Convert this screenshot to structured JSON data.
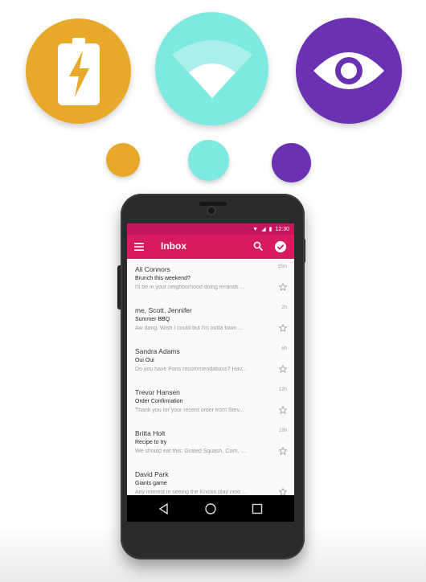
{
  "colors": {
    "battery": "#e8a82a",
    "wifi": "#7ee9e0",
    "eye": "#6a32b3",
    "toolbar": "#d81b60",
    "statusbar": "#c2185b",
    "fab": "#5ee6dd"
  },
  "icons": {
    "big": [
      "battery-charging-icon",
      "wifi-icon",
      "eye-icon"
    ],
    "small": [
      "orange-dot",
      "aqua-dot",
      "purple-dot"
    ]
  },
  "status": {
    "time": "12:30"
  },
  "toolbar": {
    "title": "Inbox"
  },
  "emails": [
    {
      "sender": "Ali Connors",
      "time": "15m",
      "subject": "Brunch this weekend?",
      "preview": "I'll be in your neighborhood doing errands ..."
    },
    {
      "sender": "me, Scott, Jennifer",
      "time": "2h",
      "subject": "Summer BBQ",
      "preview": "Aw dang. Wish I could but I'm outta town ..."
    },
    {
      "sender": "Sandra Adams",
      "time": "6h",
      "subject": "Oui Oui",
      "preview": "Do you have Paris recommendations? Hav..."
    },
    {
      "sender": "Trevor Hansen",
      "time": "12h",
      "subject": "Order Confirmation",
      "preview": "Thank you for your recent order from Stev..."
    },
    {
      "sender": "Britta Holt",
      "time": "18h",
      "subject": "Recipe to try",
      "preview": "We should eat this: Grated Squash, Corn, ..."
    },
    {
      "sender": "David Park",
      "time": "",
      "subject": "Giants game",
      "preview": "Any interest in seeing the Knicks play next ..."
    }
  ],
  "fab": {
    "label": "+"
  }
}
